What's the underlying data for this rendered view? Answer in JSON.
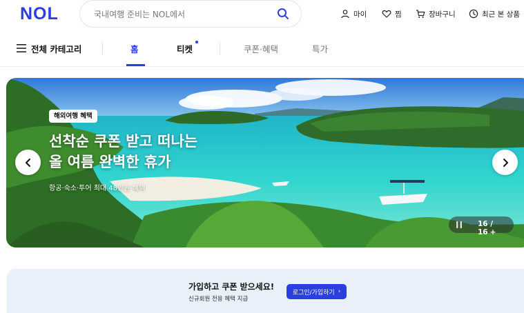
{
  "header": {
    "logo": "NOL",
    "search_placeholder": "국내여행 준비는 NOL에서",
    "utilities": [
      {
        "label": "마이",
        "icon": "person-icon"
      },
      {
        "label": "찜",
        "icon": "heart-icon"
      },
      {
        "label": "장바구니",
        "icon": "cart-icon"
      },
      {
        "label": "최근 본 상품",
        "icon": "clock-icon"
      }
    ]
  },
  "nav": {
    "all_categories": "전체 카테고리",
    "tabs": [
      {
        "label": "홈",
        "active": true
      },
      {
        "label": "티켓",
        "new_dot": true
      },
      {
        "label": "쿠폰·혜택"
      },
      {
        "label": "특가"
      }
    ]
  },
  "banner": {
    "badge": "해외여행 혜택",
    "headline_line1": "선착순 쿠폰 받고 떠나는",
    "headline_line2": "올 여름 완벽한 휴가",
    "subtext": "항공·숙소·투어 최대 48만원 혜택",
    "counter": "16 / 16",
    "counter_plus": "+"
  },
  "signup": {
    "title": "가입하고 쿠폰 받으세요!",
    "subtitle": "신규회원 전용 혜택 지급",
    "button": "로그인/가입하기",
    "button_chevron": "›"
  },
  "colors": {
    "brand": "#2b3fe0",
    "signup_bg": "#e9f0f9"
  }
}
